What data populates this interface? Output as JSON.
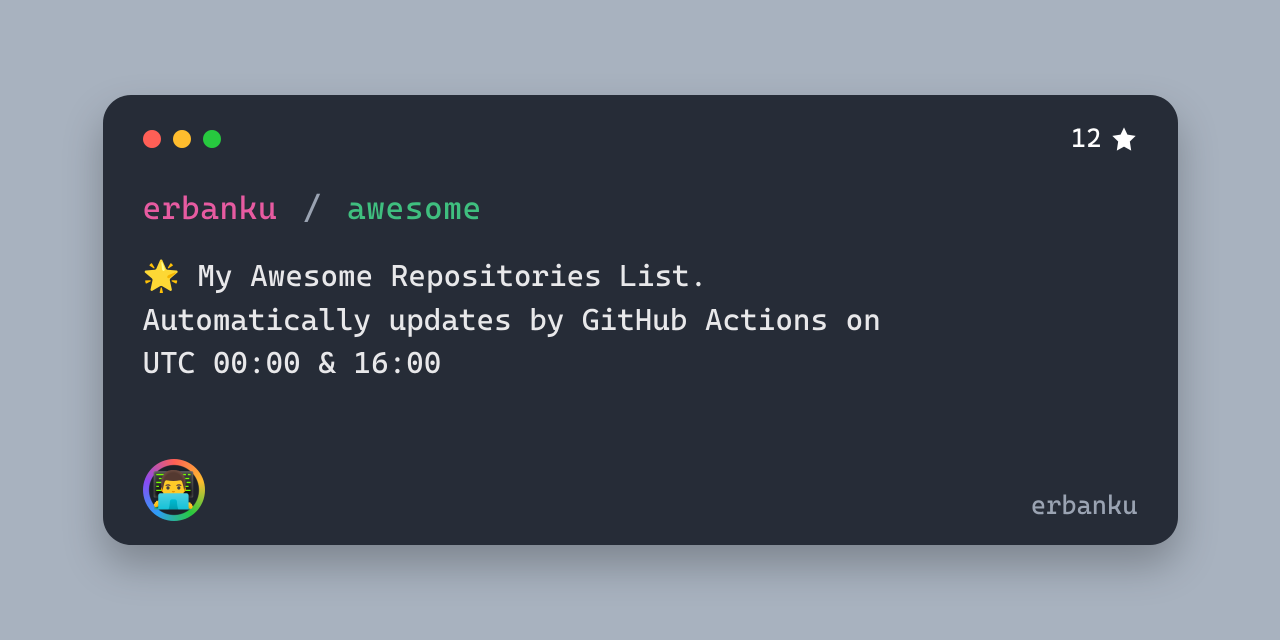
{
  "stars": "12",
  "owner": "erbanku",
  "separator": "/",
  "repo": "awesome",
  "description": "🌟 My Awesome Repositories List.\nAutomatically updates by GitHub Actions on\nUTC 00:00 & 16:00",
  "avatar_emoji": "👨‍💻",
  "username": "erbanku"
}
